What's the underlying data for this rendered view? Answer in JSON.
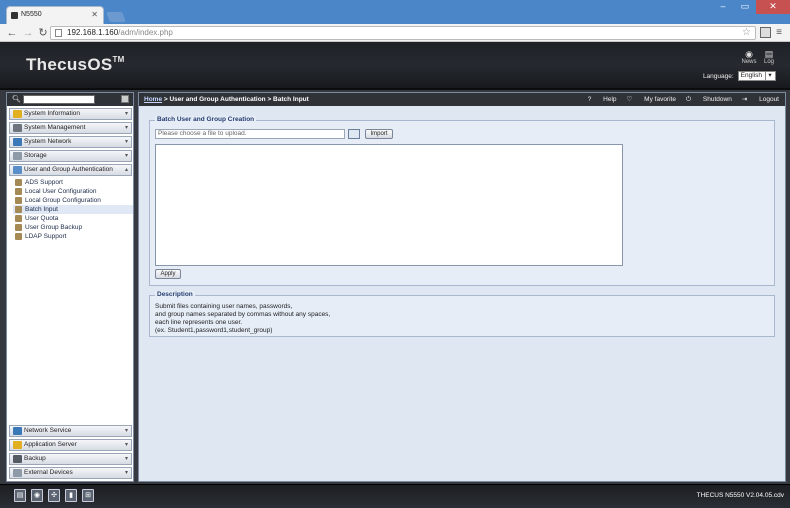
{
  "browser": {
    "tab_title": "N5550",
    "url_host": "192.168.1.160",
    "url_path": "/adm/index.php"
  },
  "header": {
    "logo": "ThecusOS",
    "logo_tm": "TM",
    "news_label": "News",
    "log_label": "Log",
    "language_label": "Language:",
    "language_value": "English"
  },
  "sidebar": {
    "groups_top": [
      {
        "label": "System Information",
        "icon": "info-icon"
      },
      {
        "label": "System Management",
        "icon": "tools-icon"
      },
      {
        "label": "System Network",
        "icon": "network-icon"
      },
      {
        "label": "Storage",
        "icon": "storage-icon"
      },
      {
        "label": "User and Group Authentication",
        "icon": "users-icon"
      }
    ],
    "sub_items": [
      "ADS Support",
      "Local User Configuration",
      "Local Group Configuration",
      "Batch Input",
      "User Quota",
      "User Group Backup",
      "LDAP Support"
    ],
    "active_sub_item": "Batch Input",
    "groups_bottom": [
      {
        "label": "Network Service",
        "icon": "network-service-icon"
      },
      {
        "label": "Application Server",
        "icon": "app-server-icon"
      },
      {
        "label": "Backup",
        "icon": "backup-icon"
      },
      {
        "label": "External Devices",
        "icon": "external-devices-icon"
      }
    ]
  },
  "breadcrumb": {
    "home": "Home",
    "path": " > User and Group Authentication > Batch Input",
    "help": "Help",
    "favorite": "My favorite",
    "shutdown": "Shutdown",
    "logout": "Logout"
  },
  "batch": {
    "legend": "Batch User and Group Creation",
    "file_placeholder": "Please choose a file to upload.",
    "import_label": "Import",
    "apply_label": "Apply"
  },
  "description": {
    "legend": "Description",
    "line1": "Submit files containing user names, passwords,",
    "line2": "and group names separated by commas without any spaces,",
    "line3": "each line represents one user.",
    "line4": "(ex. Student1,password1,student_group)"
  },
  "statusbar": {
    "version": "THECUS N5550 V2.04.05.cdv"
  },
  "colors": {
    "chrome_blue": "#4a86c8",
    "header_dark": "#1e2126",
    "content_bg": "#dfe7f3"
  }
}
